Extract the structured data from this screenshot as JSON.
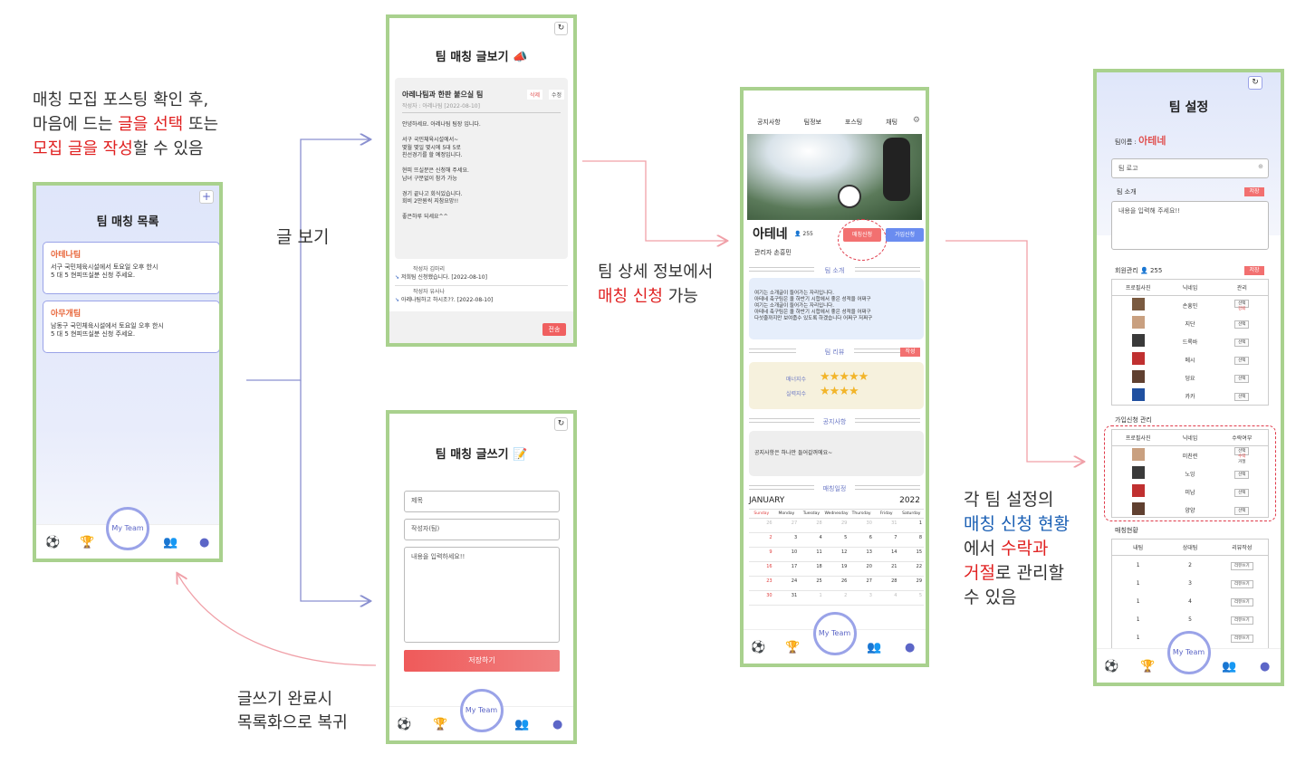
{
  "annotations": {
    "top_left": {
      "l1": "매칭 모집 포스팅 확인 후,",
      "l2a": "마음에 드는 ",
      "l2b": "글을 선택",
      "l2c": " 또는",
      "l3a": "모집 글을 작성",
      "l3b": "할 수 있음"
    },
    "view_label": "글 보기",
    "team_detail": {
      "l1": "팀 상세 정보에서",
      "l2a": "매칭 신청",
      "l2b": " 가능"
    },
    "write_done": {
      "l1": "글쓰기 완료시",
      "l2": "목록화으로 복귀"
    },
    "settings_note": {
      "l1": "각 팀 설정의",
      "l2": "매칭 신청 현황",
      "l3": "에서 ",
      "l3b": "수락과",
      "l4a": "거절",
      "l4b": "로 관리할",
      "l5": "수 있음"
    }
  },
  "screen_list": {
    "plus": "+",
    "title": "팀 매칭 목록",
    "cards": [
      {
        "name": "아테나팀",
        "line1": "서구 국민체육시설에서 토요일 오후 한시",
        "line2": "5 대 5 현피뜨실분 신청 주세요."
      },
      {
        "name": "아무개팀",
        "line1": "남동구 국민체육시설에서 토요일 오후 한시",
        "line2": "5 대 5 현피뜨실분 신청 주세요."
      }
    ],
    "myteam": "My Team"
  },
  "screen_view": {
    "refresh": "↻",
    "title": "팀 매칭 글보기",
    "post_title": "아레나팀과 한판 붙으실 팀",
    "delete": "삭제",
    "edit": "수정",
    "meta": "작성자 : 아레나팀 [2022-08-10]",
    "body": [
      "안녕하세요. 아레나팀 팀장 입니다.",
      "",
      "서구 국민체육시설에서~",
      "몇월 몇일 몇시에 5대 5로",
      "친선경기를 할 예정입니다.",
      "",
      "현피 뜨실분은 신청해 주세요.",
      "남녀 구분없이 참가 가능",
      "",
      "경기 끝나고 회식있습니다.",
      "회비 2만원씩 지참요망!!",
      "",
      "좋은하루 되세요^^"
    ],
    "comments": [
      {
        "author": "작성자 김마리",
        "text": "저희팀 신청했습니다. [2022-08-10]"
      },
      {
        "author": "작성자 유사나",
        "text": "아레나팀하고 하시조??. [2022-08-10]"
      }
    ],
    "send": "전송"
  },
  "screen_write": {
    "refresh": "↻",
    "title": "팀 매칭 글쓰기",
    "f_title": "제목",
    "f_author": "작성자(팀)",
    "f_content": "내용을 입력하세요!!",
    "save": "저장하기",
    "myteam": "My Team"
  },
  "screen_team": {
    "nav": [
      "공지사항",
      "팀정보",
      "포스팅",
      "채팅"
    ],
    "team_name": "아테네",
    "members": "255",
    "manager": "관리자 손흥민",
    "apply_match": "매칭신청",
    "join": "가입신청",
    "intro_h": "팀 소개",
    "intro": [
      "여기는 소개글이 들어가는 자리입니다.",
      "아테네 축구팀은 올 하반기 시합에서 좋은 성적을 어쩌구",
      "여기는 소개글이 들어가는 자리입니다.",
      "아테네 축구팀은 올 하반기 시합에서 좋은 성적을 어쩌구",
      "다섯줄까지만 보여줍수 있도록 하겠습니다 어쩌구 저쩌구"
    ],
    "review_h": "팀 리뷰",
    "review_btn": "작성",
    "manner": "매너지수",
    "skill": "실력지수",
    "manner_stars": 5,
    "skill_stars": 4,
    "notice_h": "공지사항",
    "notice": "공지사항은 하나만 들어갈꺼에요~",
    "schedule_h": "매칭일정",
    "month": "JANUARY",
    "year": "2022",
    "days": [
      "Sunday",
      "Monday",
      "Tuesday",
      "Wednesday",
      "Thursday",
      "Friday",
      "Saturday"
    ],
    "weeks": [
      [
        "26",
        "27",
        "28",
        "29",
        "30",
        "31",
        "1"
      ],
      [
        "2",
        "3",
        "4",
        "5",
        "6",
        "7",
        "8"
      ],
      [
        "9",
        "10",
        "11",
        "12",
        "13",
        "14",
        "15"
      ],
      [
        "16",
        "17",
        "18",
        "19",
        "20",
        "21",
        "22"
      ],
      [
        "23",
        "24",
        "25",
        "26",
        "27",
        "28",
        "29"
      ],
      [
        "30",
        "31",
        "1",
        "2",
        "3",
        "4",
        "5"
      ]
    ],
    "myteam": "My Team"
  },
  "screen_settings": {
    "refresh": "↻",
    "title": "팀 설정",
    "name_label": "팀이름 :",
    "name": "아테네",
    "logo": "팀 로고",
    "intro_label": "팀 소개",
    "save": "저장",
    "intro_ph": "내용을 입력해 주세요!!",
    "members_label": "회원관리",
    "members_count": "255",
    "member_headers": [
      "프로필사진",
      "닉네임",
      "관리"
    ],
    "members": [
      {
        "nick": "손흥민",
        "action": "선택"
      },
      {
        "nick": "지단",
        "action": "선택"
      },
      {
        "nick": "드록바",
        "action": "선택"
      },
      {
        "nick": "메시",
        "action": "선택"
      },
      {
        "nick": "덩요",
        "action": "선택"
      },
      {
        "nick": "카카",
        "action": "선택"
      }
    ],
    "member_extra": "강퇴",
    "join_label": "가입신청 관리",
    "join_headers": [
      "프로필사진",
      "닉네임",
      "수락여부"
    ],
    "joins": [
      {
        "nick": "미친련",
        "action": "선택"
      },
      {
        "nick": "노잉",
        "action": "선택"
      },
      {
        "nick": "미남",
        "action": "선택"
      },
      {
        "nick": "양양",
        "action": "선택"
      }
    ],
    "join_extra1": "수락",
    "join_extra2": "거절",
    "match_label": "매칭현황",
    "match_headers": [
      "내팀",
      "상대팀",
      "리뷰작성"
    ],
    "matches": [
      {
        "mine": "1",
        "opp": "2",
        "btn": "리뷰쓰기"
      },
      {
        "mine": "1",
        "opp": "3",
        "btn": "리뷰쓰기"
      },
      {
        "mine": "1",
        "opp": "4",
        "btn": "리뷰쓰기"
      },
      {
        "mine": "1",
        "opp": "5",
        "btn": "리뷰쓰기"
      },
      {
        "mine": "1",
        "opp": "6",
        "btn": "리뷰쓰기"
      }
    ],
    "myteam": "My Team"
  },
  "colors": {
    "frame": "#a9d18e",
    "accent": "#e02020",
    "blue": "#1a5fb4",
    "nav": "#5c66c7",
    "arrow_blue": "#8a90d0",
    "arrow_pink": "#f0a0a8"
  }
}
